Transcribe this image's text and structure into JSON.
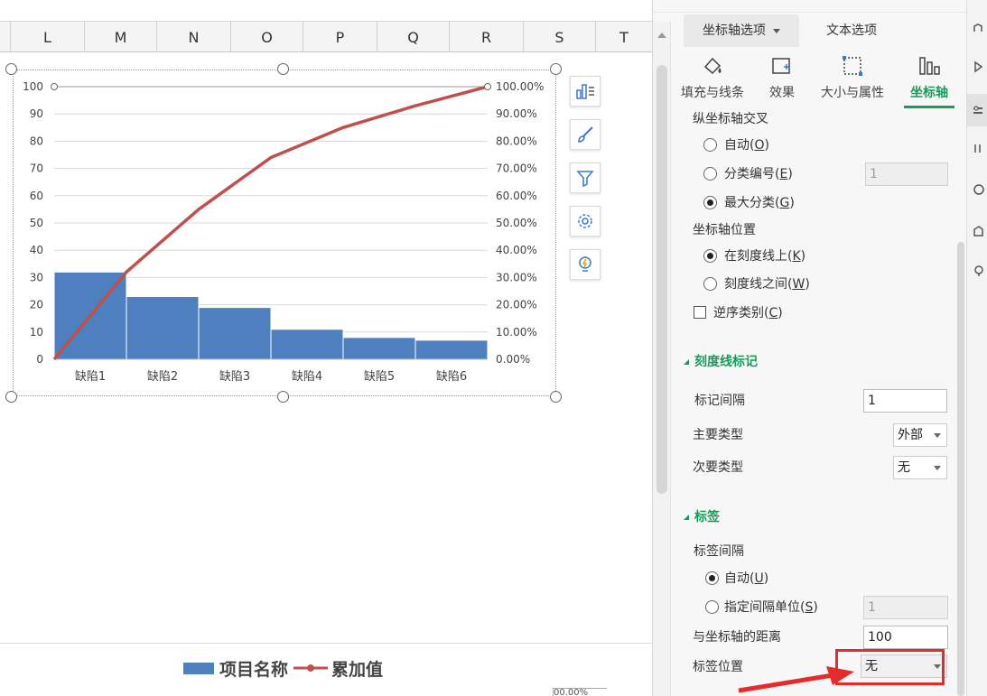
{
  "spreadsheet": {
    "columns": [
      "L",
      "M",
      "N",
      "O",
      "P",
      "Q",
      "R",
      "S",
      "T"
    ],
    "partial_cell_text": "00.00%"
  },
  "chart_data": {
    "type": "bar",
    "categories": [
      "缺陷1",
      "缺陷2",
      "缺陷3",
      "缺陷4",
      "缺陷5",
      "缺陷6"
    ],
    "series": [
      {
        "name": "项目名称",
        "type": "bar",
        "axis": "left",
        "values": [
          32,
          23,
          19,
          11,
          8,
          7
        ],
        "color": "#4e7fbf"
      },
      {
        "name": "累加值",
        "type": "line",
        "axis": "right",
        "x": [
          0,
          1,
          2,
          3,
          4,
          5,
          6
        ],
        "values": [
          0,
          32,
          55,
          74,
          85,
          93,
          100
        ],
        "color": "#c0504d"
      }
    ],
    "left_axis": {
      "ticks": [
        "0",
        "10",
        "20",
        "30",
        "40",
        "50",
        "60",
        "70",
        "80",
        "90",
        "100"
      ],
      "ylim": [
        0,
        100
      ]
    },
    "right_axis": {
      "ticks": [
        "0.00%",
        "10.00%",
        "20.00%",
        "30.00%",
        "40.00%",
        "50.00%",
        "60.00%",
        "70.00%",
        "80.00%",
        "90.00%",
        "100.00%"
      ],
      "ylim": [
        0,
        1
      ]
    },
    "legend": {
      "position": "bottom",
      "entries": [
        "项目名称",
        "累加值"
      ]
    },
    "grid": true
  },
  "chart_tools": [
    "chart-elements-icon",
    "chart-style-brush-icon",
    "chart-filter-icon",
    "chart-settings-gear-icon",
    "chart-ideas-bulb-icon"
  ],
  "pane": {
    "tabs": {
      "axis_options": "坐标轴选项",
      "text_options": "文本选项"
    },
    "subtabs": {
      "fill_line": "填充与线条",
      "effects": "效果",
      "size_props": "大小与属性",
      "axis": "坐标轴"
    },
    "cross": {
      "title": "纵坐标轴交叉",
      "auto": "自动(",
      "auto_key": "O",
      "category_number": "分类编号(",
      "category_number_key": "E",
      "category_number_value": "1",
      "max_category": "最大分类(",
      "max_category_key": "G"
    },
    "axis_position": {
      "title": "坐标轴位置",
      "on_tick": "在刻度线上(",
      "on_tick_key": "K",
      "between_tick": "刻度线之间(",
      "between_tick_key": "W"
    },
    "reverse": {
      "label": "逆序类别(",
      "key": "C"
    },
    "tick_marks": {
      "title": "刻度线标记",
      "interval_label": "标记间隔",
      "interval_value": "1",
      "major_label": "主要类型",
      "major_value": "外部",
      "minor_label": "次要类型",
      "minor_value": "无"
    },
    "labels": {
      "title": "标签",
      "interval_title": "标签间隔",
      "auto": "自动(",
      "auto_key": "U",
      "specify": "指定间隔单位(",
      "specify_key": "S",
      "specify_value": "1",
      "distance_label": "与坐标轴的距离",
      "distance_value": "100",
      "position_label": "标签位置",
      "position_value": "无"
    },
    "accent_color": "#1a9a5a"
  },
  "annotation_color": "#e52b2b",
  "paren_close": ")"
}
